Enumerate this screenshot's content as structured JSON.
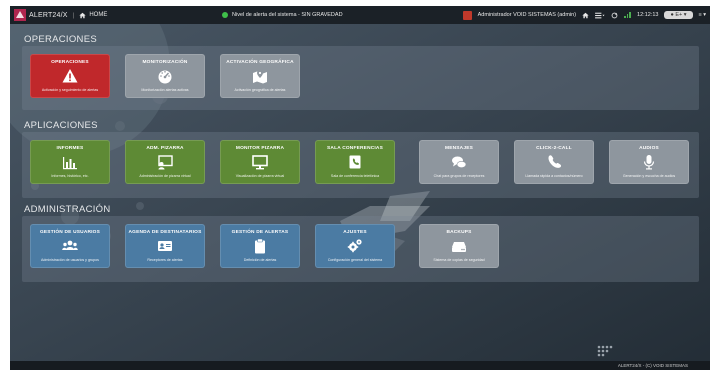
{
  "topbar": {
    "brand": "ALERT24/X",
    "home_label": "HOME",
    "alert_level": "Nivel de alerta del sistema - SIN GRAVEDAD",
    "user": "Administrador VOID SISTEMAS (admin)",
    "time": "12:12:13",
    "status_pill": "● E+ ▾",
    "menu": "≡ ▾"
  },
  "sections": {
    "operaciones": {
      "title": "OPERACIONES",
      "tiles": [
        {
          "title": "OPERACIONES",
          "desc": "Activación y seguimiento de alertas",
          "icon": "warning-icon",
          "color": "red"
        },
        {
          "title": "MONITORIZACIÓN",
          "desc": "Monitorización alertas activas",
          "icon": "dashboard-gauge-icon",
          "color": "grey"
        },
        {
          "title": "ACTIVACIÓN GEOGRÁFICA",
          "desc": "Activación geográfica de alertas",
          "icon": "map-marker-icon",
          "color": "grey"
        }
      ]
    },
    "aplicaciones": {
      "title": "APLICACIONES",
      "tiles": [
        {
          "title": "INFORMES",
          "desc": "Informes, histórico, etc.",
          "icon": "bar-chart-icon",
          "color": "green"
        },
        {
          "title": "ADM. PIZARRA",
          "desc": "Administración de pizarra virtual",
          "icon": "whiteboard-icon",
          "color": "green"
        },
        {
          "title": "MONITOR PIZARRA",
          "desc": "Visualización de pizarra virtual",
          "icon": "monitor-icon",
          "color": "green"
        },
        {
          "title": "SALA CONFERENCIAS",
          "desc": "Sala de conferencia telefónica",
          "icon": "phone-book-icon",
          "color": "green"
        },
        {
          "title": "MENSAJES",
          "desc": "Chat para grupos de receptores",
          "icon": "chat-icon",
          "color": "grey"
        },
        {
          "title": "CLICK-2-CALL",
          "desc": "Llamada rápida a contactos/número",
          "icon": "phone-icon",
          "color": "grey"
        },
        {
          "title": "AUDIOS",
          "desc": "Generación y escucha de audios",
          "icon": "microphone-icon",
          "color": "grey"
        }
      ]
    },
    "administracion": {
      "title": "ADMINISTRACIÓN",
      "tiles": [
        {
          "title": "GESTIÓN DE USUARIOS",
          "desc": "Administración de usuarios y grupos",
          "icon": "users-icon",
          "color": "blue"
        },
        {
          "title": "AGENDA DE DESTINATARIOS",
          "desc": "Receptores de alertas",
          "icon": "address-card-icon",
          "color": "blue"
        },
        {
          "title": "GESTIÓN DE ALERTAS",
          "desc": "Definición de alertas",
          "icon": "clipboard-icon",
          "color": "blue"
        },
        {
          "title": "AJUSTES",
          "desc": "Configuración general del sistema",
          "icon": "cogs-icon",
          "color": "blue"
        },
        {
          "title": "BACKUPS",
          "desc": "Sistema de copias de seguridad",
          "icon": "hard-drive-icon",
          "color": "grey"
        }
      ]
    }
  },
  "footer": {
    "text": "ALERT24/X - (C) VOID SISTEMAS"
  }
}
